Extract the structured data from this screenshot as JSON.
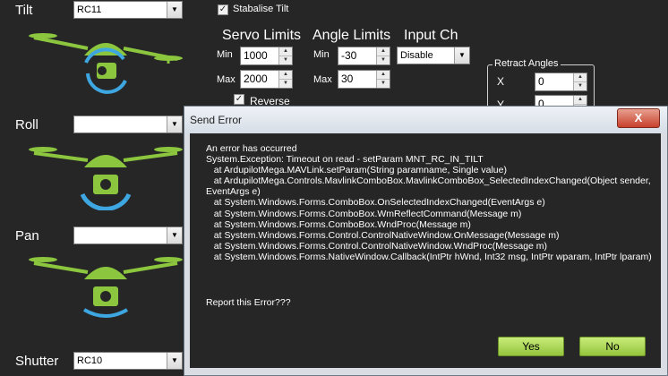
{
  "tilt": {
    "label": "Tilt",
    "combo_value": "RC11",
    "stabilise_label": "Stabalise Tilt",
    "stabilise_checked": true
  },
  "servo_limits": {
    "title": "Servo Limits",
    "min_label": "Min",
    "min_value": "1000",
    "max_label": "Max",
    "max_value": "2000"
  },
  "angle_limits": {
    "title": "Angle Limits",
    "min_label": "Min",
    "min_value": "-30",
    "max_label": "Max",
    "max_value": "30"
  },
  "input_ch": {
    "title": "Input Ch",
    "value": "Disable"
  },
  "reverse": {
    "label": "Reverse",
    "checked": true
  },
  "retract_angles": {
    "title": "Retract Angles",
    "x_label": "X",
    "x_value": "0",
    "y_label": "Y",
    "y_value": "0"
  },
  "roll": {
    "label": "Roll",
    "combo_value": ""
  },
  "pan": {
    "label": "Pan",
    "combo_value": ""
  },
  "shutter": {
    "label": "Shutter",
    "combo_value": "RC10"
  },
  "icons": {
    "drone": "drone-icon",
    "camera": "camera-icon",
    "dropdown": "chevron-down-icon",
    "close": "close-icon"
  },
  "colors": {
    "drone_green": "#8cc63f",
    "arrow_blue": "#3ea6e0",
    "button_green": "#a6d65a",
    "background": "#262626"
  },
  "dialog": {
    "title": "Send Error",
    "close_glyph": "X",
    "message": "An error has occurred\nSystem.Exception: Timeout on read - setParam MNT_RC_IN_TILT\n   at ArdupilotMega.MAVLink.setParam(String paramname, Single value)\n   at ArdupilotMega.Controls.MavlinkComboBox.MavlinkComboBox_SelectedIndexChanged(Object sender, EventArgs e)\n   at System.Windows.Forms.ComboBox.OnSelectedIndexChanged(EventArgs e)\n   at System.Windows.Forms.ComboBox.WmReflectCommand(Message m)\n   at System.Windows.Forms.ComboBox.WndProc(Message m)\n   at System.Windows.Forms.Control.ControlNativeWindow.OnMessage(Message m)\n   at System.Windows.Forms.Control.ControlNativeWindow.WndProc(Message m)\n   at System.Windows.Forms.NativeWindow.Callback(IntPtr hWnd, Int32 msg, IntPtr wparam, IntPtr lparam)",
    "report_question": "Report this Error???",
    "yes_label": "Yes",
    "no_label": "No"
  }
}
